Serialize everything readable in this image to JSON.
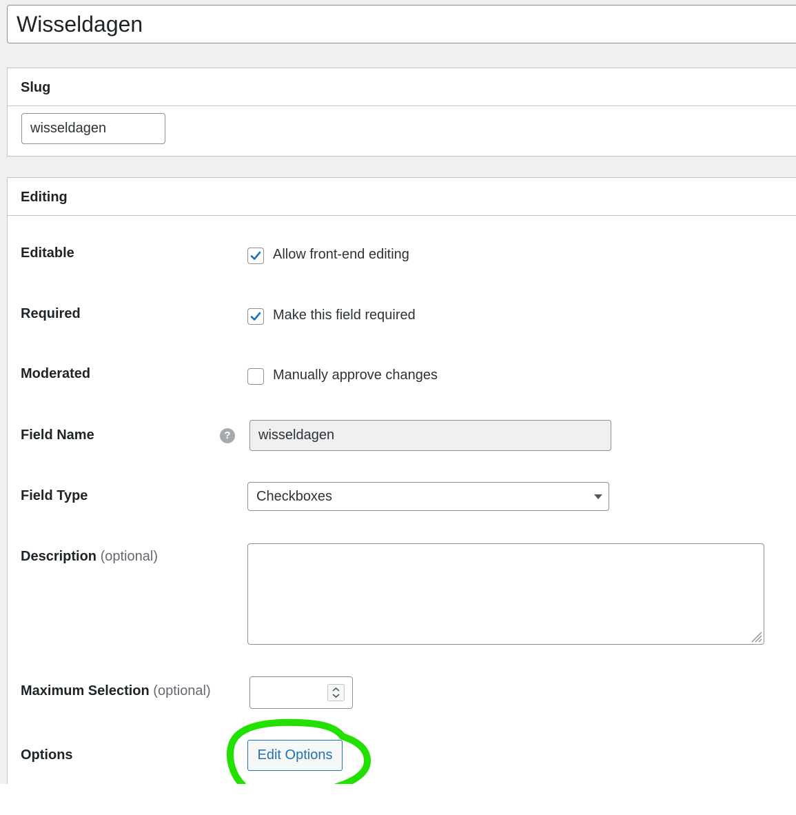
{
  "title": {
    "value": "Wisseldagen"
  },
  "slug_box": {
    "heading": "Slug",
    "slug_value": "wisseldagen"
  },
  "editing_box": {
    "heading": "Editing",
    "rows": {
      "editable": {
        "label": "Editable",
        "checkbox_label": "Allow front-end editing",
        "checked": true
      },
      "required": {
        "label": "Required",
        "checkbox_label": "Make this field required",
        "checked": true
      },
      "moderated": {
        "label": "Moderated",
        "checkbox_label": "Manually approve changes",
        "checked": false
      },
      "field_name": {
        "label": "Field Name",
        "help_icon": "question-circle-icon",
        "help_glyph": "?",
        "value": "wisseldagen"
      },
      "field_type": {
        "label": "Field Type",
        "selected": "Checkboxes"
      },
      "description": {
        "label": "Description",
        "optional": "(optional)",
        "value": ""
      },
      "max_selection": {
        "label": "Maximum Selection",
        "optional": "(optional)",
        "value": ""
      },
      "options": {
        "label": "Options",
        "button_label": "Edit Options"
      }
    }
  },
  "annotation": {
    "type": "hand-drawn circle",
    "color": "#22e000"
  },
  "colors": {
    "accent": "#2271b1",
    "checkmark": "#2271b1",
    "admin_bg": "#f0f0f1"
  }
}
